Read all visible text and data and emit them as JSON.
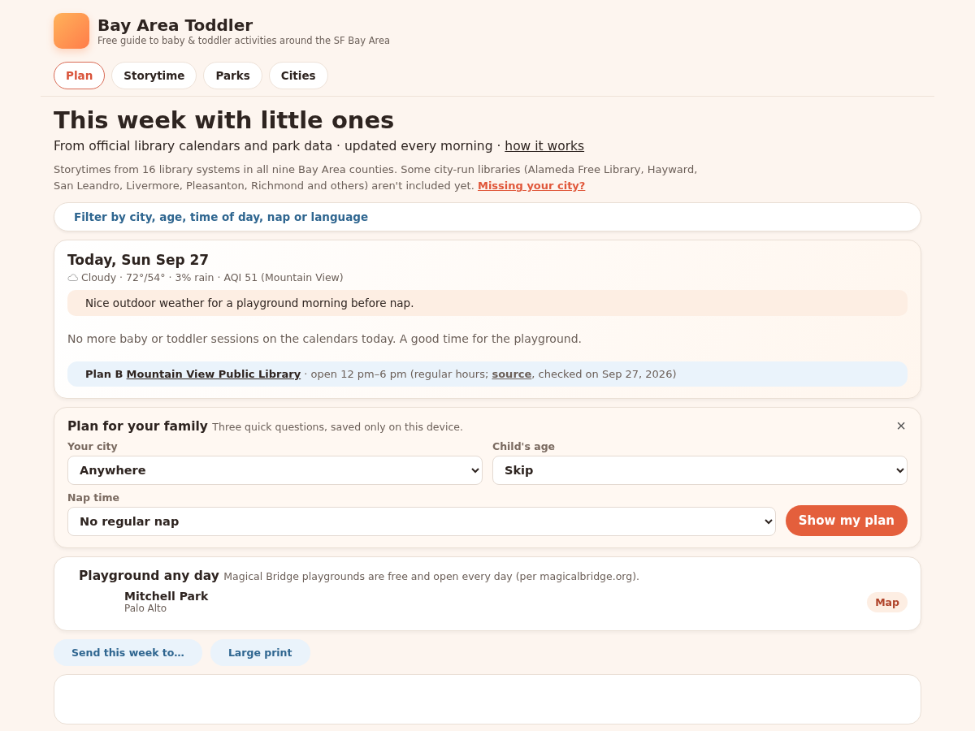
{
  "brand": {
    "title": "Bay Area Toddler",
    "tagline": "Free guide to baby & toddler activities around the SF Bay Area"
  },
  "tabs": [
    {
      "label": "Plan",
      "selected": true
    },
    {
      "label": "Storytime",
      "selected": false
    },
    {
      "label": "Parks",
      "selected": false
    },
    {
      "label": "Cities",
      "selected": false
    }
  ],
  "heading": "This week with little ones",
  "subheading": {
    "text": "From official library calendars and park data · updated every morning · ",
    "link": "how it works"
  },
  "intro": {
    "text": "Storytimes from 16 library systems in all nine Bay Area counties. Some city-run libraries (Alameda Free Library, Hayward, San Leandro, Livermore, Pleasanton, Richmond and others) aren't included yet. ",
    "link": "Missing your city?"
  },
  "filter": {
    "label": "Filter by city, age, time of day, nap or language"
  },
  "today": {
    "title": "Today, Sun Sep 27",
    "weather": "Cloudy · 72°/54° · 3% rain · AQI 51 (Mountain View)",
    "tip": "Nice outdoor weather for a playground morning before nap.",
    "note": "No more baby or toddler sessions on the calendars today. A good time for the playground.",
    "plan_b": {
      "label": "Plan B",
      "library": "Mountain View Public Library",
      "before": " · open 12 pm–6 pm (regular hours; ",
      "source": "source",
      "after": ", checked on Sep 27, 2026)"
    }
  },
  "family_plan": {
    "title": "Plan for your family",
    "subtitle": "Three quick questions, saved only on this device.",
    "close": "×",
    "fields": [
      {
        "label": "Your city",
        "value": "Anywhere"
      },
      {
        "label": "Child's age",
        "value": "Skip"
      },
      {
        "label": "Nap time",
        "value": "No regular nap"
      }
    ],
    "button": "Show my plan"
  },
  "playground": {
    "title": "Playground any day",
    "subtitle": "Magical Bridge playgrounds are free and open every day (per magicalbridge.org).",
    "parks": [
      {
        "name": "Mitchell Park",
        "city": "Palo Alto",
        "action": "Map"
      }
    ]
  },
  "actions": [
    "Send this week to…",
    "Large print"
  ]
}
